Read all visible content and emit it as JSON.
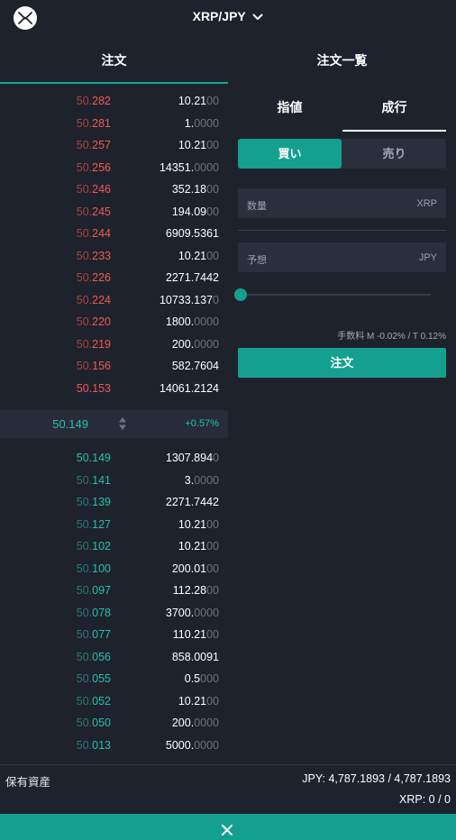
{
  "header": {
    "pair": "XRP/JPY",
    "logo_icon": "xrp-logo-icon",
    "chevron_icon": "chevron-down-icon"
  },
  "tabs": {
    "order": "注文",
    "order_list": "注文一覧"
  },
  "order_book": {
    "asks": [
      {
        "price_dim": "50.",
        "price_hi": "282",
        "amount_main": "10.21",
        "amount_dim": "00"
      },
      {
        "price_dim": "50.",
        "price_hi": "281",
        "amount_main": "1.",
        "amount_dim": "0000"
      },
      {
        "price_dim": "50.",
        "price_hi": "257",
        "amount_main": "10.21",
        "amount_dim": "00"
      },
      {
        "price_dim": "50.",
        "price_hi": "256",
        "amount_main": "14351.",
        "amount_dim": "0000"
      },
      {
        "price_dim": "50.",
        "price_hi": "246",
        "amount_main": "352.18",
        "amount_dim": "00"
      },
      {
        "price_dim": "50.",
        "price_hi": "245",
        "amount_main": "194.09",
        "amount_dim": "00"
      },
      {
        "price_dim": "50.",
        "price_hi": "244",
        "amount_main": "6909.5361",
        "amount_dim": ""
      },
      {
        "price_dim": "50.",
        "price_hi": "233",
        "amount_main": "10.21",
        "amount_dim": "00"
      },
      {
        "price_dim": "50.",
        "price_hi": "226",
        "amount_main": "2271.7442",
        "amount_dim": ""
      },
      {
        "price_dim": "50.",
        "price_hi": "224",
        "amount_main": "10733.137",
        "amount_dim": "0"
      },
      {
        "price_dim": "50.",
        "price_hi": "220",
        "amount_main": "1800.",
        "amount_dim": "0000"
      },
      {
        "price_dim": "50.",
        "price_hi": "219",
        "amount_main": "200.",
        "amount_dim": "0000"
      },
      {
        "price_dim": "50.",
        "price_hi": "156",
        "amount_main": "582.7604",
        "amount_dim": ""
      },
      {
        "price_dim": "",
        "price_hi": "50.153",
        "amount_main": "14061.2124",
        "amount_dim": ""
      }
    ],
    "mid": {
      "price": "50.149",
      "change": "+0.57%",
      "sort_icon": "sort-arrows-icon"
    },
    "bids": [
      {
        "price_dim": "",
        "price_hi": "50.149",
        "amount_main": "1307.894",
        "amount_dim": "0"
      },
      {
        "price_dim": "50.",
        "price_hi": "141",
        "amount_main": "3.",
        "amount_dim": "0000"
      },
      {
        "price_dim": "50.",
        "price_hi": "139",
        "amount_main": "2271.7442",
        "amount_dim": ""
      },
      {
        "price_dim": "50.",
        "price_hi": "127",
        "amount_main": "10.21",
        "amount_dim": "00"
      },
      {
        "price_dim": "50.",
        "price_hi": "102",
        "amount_main": "10.21",
        "amount_dim": "00"
      },
      {
        "price_dim": "50.",
        "price_hi": "100",
        "amount_main": "200.01",
        "amount_dim": "00"
      },
      {
        "price_dim": "50.",
        "price_hi": "097",
        "amount_main": "112.28",
        "amount_dim": "00"
      },
      {
        "price_dim": "50.",
        "price_hi": "078",
        "amount_main": "3700.",
        "amount_dim": "0000"
      },
      {
        "price_dim": "50.",
        "price_hi": "077",
        "amount_main": "110.21",
        "amount_dim": "00"
      },
      {
        "price_dim": "50.",
        "price_hi": "056",
        "amount_main": "858.0091",
        "amount_dim": ""
      },
      {
        "price_dim": "50.",
        "price_hi": "055",
        "amount_main": "0.5",
        "amount_dim": "000"
      },
      {
        "price_dim": "50.",
        "price_hi": "052",
        "amount_main": "10.21",
        "amount_dim": "00"
      },
      {
        "price_dim": "50.",
        "price_hi": "050",
        "amount_main": "200.",
        "amount_dim": "0000"
      },
      {
        "price_dim": "50.",
        "price_hi": "013",
        "amount_main": "5000.",
        "amount_dim": "0000"
      }
    ]
  },
  "order_form": {
    "type_tabs": {
      "limit": "指値",
      "market": "成行"
    },
    "side": {
      "buy": "買い",
      "sell": "売り"
    },
    "quantity": {
      "label": "数量",
      "unit": "XRP"
    },
    "estimate": {
      "label": "予想",
      "unit": "JPY"
    },
    "slider_value": 0,
    "fee": "手数料 M -0.02% / T 0.12%",
    "submit": "注文"
  },
  "assets": {
    "label": "保有資産",
    "jpy": "JPY: 4,787.1893 / 4,787.1893",
    "xrp": "XRP: 0 / 0"
  },
  "footer": {
    "close_icon": "close-icon"
  },
  "colors": {
    "background": "#1e222d",
    "accent": "#13a08f",
    "ask": "#ee5b50",
    "bid": "#22c1ae"
  }
}
